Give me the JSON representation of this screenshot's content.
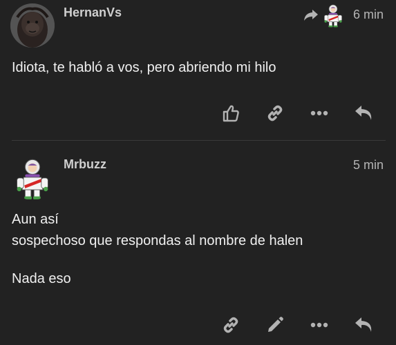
{
  "posts": [
    {
      "username": "HernanVs",
      "time": "6 min",
      "paragraphs": [
        "Idiota, te habló a vos, pero abriendo mi hilo"
      ],
      "avatar_icon": "gorilla-avatar",
      "reply_to_avatar_icon": "buzz-avatar",
      "actions": [
        "like-icon",
        "link-icon",
        "more-icon",
        "reply-icon"
      ]
    },
    {
      "username": "Mrbuzz",
      "time": "5 min",
      "paragraphs": [
        "Aun así",
        "sospechoso que respondas al nombre de halen",
        "Nada eso"
      ],
      "avatar_icon": "buzz-avatar",
      "actions": [
        "link-icon",
        "edit-icon",
        "more-icon",
        "reply-icon"
      ]
    }
  ],
  "colors": {
    "background": "#222222",
    "text": "#f0f0f0",
    "muted": "#b5b5b5",
    "icon": "#b3b3b3"
  }
}
